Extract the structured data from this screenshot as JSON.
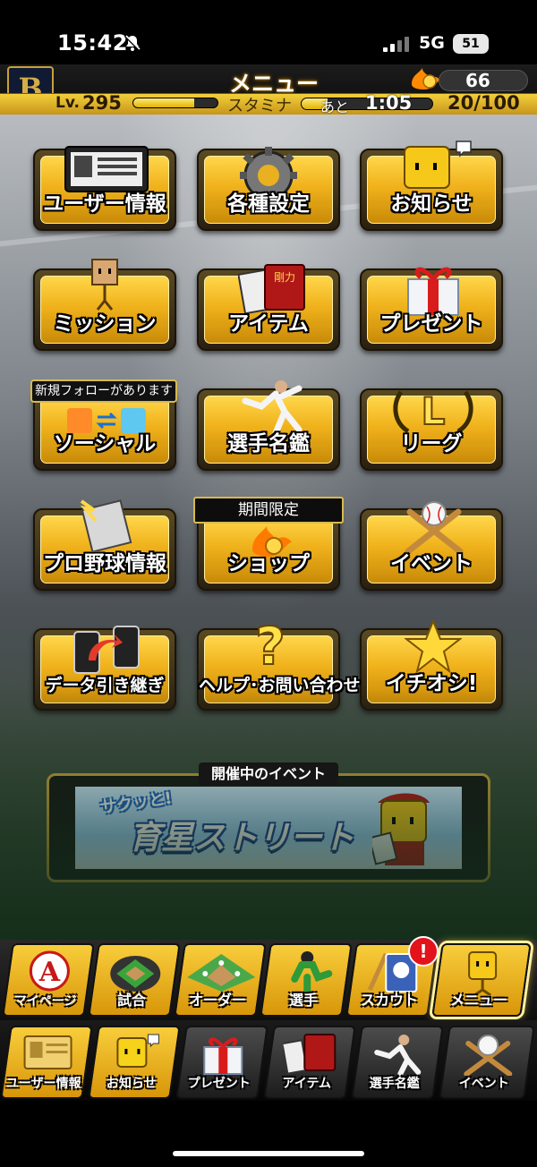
{
  "status": {
    "time": "15:42",
    "network": "5G",
    "battery": "51"
  },
  "header": {
    "title": "メニュー",
    "coins": "66",
    "level_label": "Lv.",
    "level": "295",
    "exp_progress": 0.72,
    "stamina_label": "スタミナ",
    "stamina_progress": 0.2,
    "time_label": "あと",
    "time_remaining": "1:05",
    "stamina_value": "20/100",
    "logo_letter": "B"
  },
  "menu": {
    "tiles": [
      {
        "label": "ユーザー情報"
      },
      {
        "label": "各種設定"
      },
      {
        "label": "お知らせ"
      },
      {
        "label": "ミッション"
      },
      {
        "label": "アイテム"
      },
      {
        "label": "プレゼント"
      },
      {
        "label": "ソーシャル"
      },
      {
        "label": "選手名鑑"
      },
      {
        "label": "リーグ"
      },
      {
        "label": "プロ野球情報"
      },
      {
        "label": "ショップ"
      },
      {
        "label": "イベント"
      },
      {
        "label": "データ引き継ぎ"
      },
      {
        "label": "ヘルプ･お問い合わせ"
      },
      {
        "label": "イチオシ!"
      }
    ],
    "social_note": "新規フォローがあります",
    "shop_banner": "期間限定",
    "item_book_text": "剛力",
    "league_letter": "L"
  },
  "event": {
    "heading": "開催中のイベント",
    "banner_sub": "サクッと!",
    "banner_title": "育星ストリート"
  },
  "nav_primary": [
    {
      "label": "マイページ"
    },
    {
      "label": "試合"
    },
    {
      "label": "オーダー"
    },
    {
      "label": "選手"
    },
    {
      "label": "スカウト"
    },
    {
      "label": "メニュー"
    }
  ],
  "nav_badge": "!",
  "nav_shortcuts": [
    {
      "label": "ユーザー情報"
    },
    {
      "label": "お知らせ"
    },
    {
      "label": "プレゼント"
    },
    {
      "label": "アイテム"
    },
    {
      "label": "選手名鑑"
    },
    {
      "label": "イベント"
    }
  ],
  "colors": {
    "gold": "#f0b21c",
    "dark": "#151515",
    "badge": "#e3121b"
  }
}
